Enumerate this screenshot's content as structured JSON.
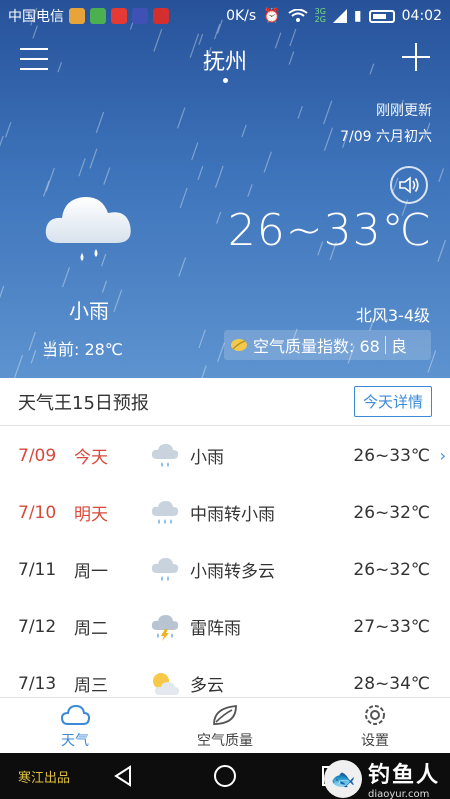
{
  "status_bar": {
    "carrier": "中国电信",
    "net_speed": "0K/s",
    "time": "04:02",
    "signal_labels": [
      "3G",
      "2G"
    ]
  },
  "header": {
    "city": "抚州",
    "menu_icon": "menu-icon",
    "add_icon": "plus-icon"
  },
  "weather": {
    "updated": "刚刚更新",
    "date_lunar": "7/09 六月初六",
    "temp_range": "26~33℃",
    "condition": "小雨",
    "current": "当前: 28℃",
    "wind": "北风3-4级",
    "aqi_label": "空气质量指数: 68",
    "aqi_level": "良"
  },
  "forecast": {
    "title": "天气王15日预报",
    "detail_button": "今天详情",
    "rows": [
      {
        "date": "7/09",
        "day": "今天",
        "icon": "light-rain-icon",
        "cond": "小雨",
        "temp": "26~33℃"
      },
      {
        "date": "7/10",
        "day": "明天",
        "icon": "moderate-rain-icon",
        "cond": "中雨转小雨",
        "temp": "26~32℃"
      },
      {
        "date": "7/11",
        "day": "周一",
        "icon": "light-rain-icon",
        "cond": "小雨转多云",
        "temp": "26~32℃"
      },
      {
        "date": "7/12",
        "day": "周二",
        "icon": "thunderstorm-icon",
        "cond": "雷阵雨",
        "temp": "27~33℃"
      },
      {
        "date": "7/13",
        "day": "周三",
        "icon": "partly-cloudy-icon",
        "cond": "多云",
        "temp": "28~34℃"
      }
    ]
  },
  "tabs": {
    "weather": "天气",
    "air": "空气质量",
    "settings": "设置"
  },
  "nav": {
    "brand": "寒江出品"
  },
  "watermark": {
    "text": "钓鱼人",
    "url": "diaoyur.com"
  },
  "colors": {
    "accent": "#3b8ad9",
    "highlight_red": "#d9483b",
    "sky_top": "#27529a",
    "sky_bottom": "#5d93cf"
  }
}
